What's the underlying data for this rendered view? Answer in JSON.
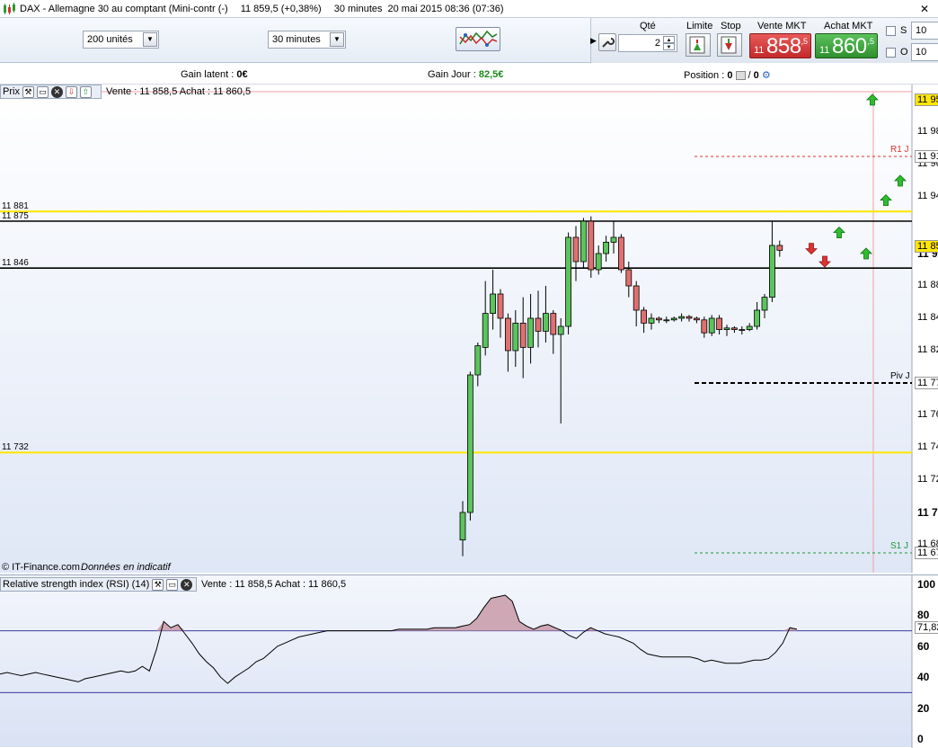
{
  "window": {
    "title": "DAX - Allemagne 30 au comptant (Mini-contr (-)",
    "price": "11 859,5 (+0,38%)",
    "interval": "30 minutes",
    "datetime": "20 mai 2015 08:36 (07:36)"
  },
  "toolbar": {
    "units_select": "200 unités",
    "interval_select": "30 minutes"
  },
  "order": {
    "qty_label": "Qté",
    "qty_value": "2",
    "limit_label": "Limite",
    "stop_label": "Stop",
    "sell_label": "Vente MKT",
    "buy_label": "Achat MKT",
    "sell_small": "11",
    "sell_big": "858",
    "sell_sup": ",5",
    "buy_small": "11",
    "buy_big": "860",
    "buy_sup": ",5",
    "s_label": "S",
    "o_label": "O",
    "s_value": "10",
    "o_value": "10"
  },
  "info": {
    "gain_latent_label": "Gain latent : ",
    "gain_latent_value": "0€",
    "gain_jour_label": "Gain Jour : ",
    "gain_jour_value": "82,5€",
    "position_label": "Position : ",
    "position_value_1": "0",
    "position_sep": " / ",
    "position_value_2": "0"
  },
  "main_panel": {
    "name": "Prix",
    "quote": "Vente : 11 858,5 Achat : 11 860,5",
    "footer_brand": "© IT-Finance.com",
    "footer_note": "Données en indicatif",
    "levels": [
      {
        "label": "11 881",
        "value": 11881,
        "color": "#ffe600"
      },
      {
        "label": "11 875",
        "value": 11875,
        "color": "#000000"
      },
      {
        "label": "11 846",
        "value": 11846,
        "color": "#000000"
      },
      {
        "label": "11 732",
        "value": 11732,
        "color": "#ffe600"
      }
    ],
    "pivots": [
      {
        "label": "R1 J",
        "value": 11915,
        "color": "#e03030"
      },
      {
        "label": "Piv J",
        "value": 11775,
        "color": "#000000"
      },
      {
        "label": "S1 J",
        "value": 11670,
        "color": "#1a9a3a"
      }
    ],
    "axis_labels": [
      {
        "text": "11 95",
        "value": 11950,
        "bold": false
      },
      {
        "text": "11 98",
        "value": 11930,
        "bold": false
      },
      {
        "text": "11 96",
        "value": 11910,
        "bold": false
      },
      {
        "text": "11 94",
        "value": 11890,
        "bold": false
      },
      {
        "text": "11 9",
        "value": 11855,
        "bold": true
      },
      {
        "text": "11 88",
        "value": 11835,
        "bold": false
      },
      {
        "text": "11 84",
        "value": 11815,
        "bold": false
      },
      {
        "text": "11 82",
        "value": 11795,
        "bold": false
      },
      {
        "text": "11 8",
        "value": 11775,
        "bold": true
      },
      {
        "text": "11 76",
        "value": 11755,
        "bold": false
      },
      {
        "text": "11 74",
        "value": 11735,
        "bold": false
      },
      {
        "text": "11 72",
        "value": 11715,
        "bold": false
      },
      {
        "text": "11 7",
        "value": 11695,
        "bold": true
      },
      {
        "text": "11 68",
        "value": 11675,
        "bold": false
      }
    ],
    "tags": [
      {
        "text": "11 95",
        "value": 11950,
        "bg": "#ffe600"
      },
      {
        "text": "11 91",
        "value": 11915,
        "bg": "#ffffff"
      },
      {
        "text": "11 85",
        "value": 11859.5,
        "bg": "#ffe600"
      },
      {
        "text": "11 77",
        "value": 11775,
        "bg": "#ffffff"
      },
      {
        "text": "11 67",
        "value": 11670,
        "bg": "#ffffff"
      }
    ]
  },
  "chart_data": {
    "type": "candlestick",
    "ylim": [
      11665,
      11955
    ],
    "candles": [
      [
        11678,
        11695,
        11668,
        11702
      ],
      [
        11695,
        11780,
        11690,
        11782
      ],
      [
        11780,
        11798,
        11773,
        11800
      ],
      [
        11797,
        11818,
        11792,
        11838
      ],
      [
        11818,
        11830,
        11808,
        11845
      ],
      [
        11830,
        11815,
        11803,
        11833
      ],
      [
        11815,
        11795,
        11782,
        11818
      ],
      [
        11795,
        11812,
        11785,
        11820
      ],
      [
        11812,
        11797,
        11778,
        11828
      ],
      [
        11797,
        11815,
        11787,
        11830
      ],
      [
        11815,
        11807,
        11797,
        11832
      ],
      [
        11807,
        11818,
        11800,
        11835
      ],
      [
        11818,
        11805,
        11793,
        11820
      ],
      [
        11805,
        11810,
        11750,
        11815
      ],
      [
        11810,
        11865,
        11805,
        11868
      ],
      [
        11865,
        11850,
        11838,
        11872
      ],
      [
        11850,
        11875,
        11846,
        11877
      ],
      [
        11875,
        11845,
        11840,
        11878
      ],
      [
        11845,
        11855,
        11842,
        11860
      ],
      [
        11855,
        11862,
        11850,
        11866
      ],
      [
        11862,
        11865,
        11855,
        11875
      ],
      [
        11865,
        11845,
        11843,
        11867
      ],
      [
        11845,
        11835,
        11828,
        11850
      ],
      [
        11835,
        11820,
        11810,
        11838
      ],
      [
        11820,
        11812,
        11806,
        11822
      ],
      [
        11812,
        11815,
        11808,
        11818
      ],
      [
        11815,
        11814,
        11812,
        11816
      ],
      [
        11814,
        11814,
        11812,
        11816
      ],
      [
        11814,
        11815,
        11813,
        11816
      ],
      [
        11815,
        11816,
        11813,
        11818
      ],
      [
        11816,
        11815,
        11813,
        11817
      ],
      [
        11815,
        11814,
        11812,
        11816
      ],
      [
        11814,
        11806,
        11803,
        11816
      ],
      [
        11806,
        11815,
        11804,
        11817
      ],
      [
        11815,
        11808,
        11805,
        11817
      ],
      [
        11808,
        11809,
        11804,
        11811
      ],
      [
        11809,
        11808,
        11806,
        11810
      ],
      [
        11808,
        11808,
        11805,
        11810
      ],
      [
        11808,
        11810,
        11807,
        11812
      ],
      [
        11810,
        11820,
        11808,
        11825
      ],
      [
        11820,
        11828,
        11815,
        11830
      ],
      [
        11828,
        11860,
        11825,
        11875
      ],
      [
        11860,
        11857,
        11853,
        11863
      ]
    ],
    "arrows_up": [
      11950,
      11855,
      11868,
      11888,
      11900
    ],
    "arrows_down": [
      11858,
      11850
    ]
  },
  "rsi_panel": {
    "name": "Relative strength index (RSI) (14)",
    "quote": "Vente : 11 858,5 Achat : 11 860,5",
    "ylim": [
      0,
      100
    ],
    "overbought": 70,
    "oversold": 30,
    "axis_labels": [
      {
        "text": "100",
        "value": 100
      },
      {
        "text": "80",
        "value": 80
      },
      {
        "text": "60",
        "value": 60
      },
      {
        "text": "40",
        "value": 40
      },
      {
        "text": "20",
        "value": 20
      },
      {
        "text": "0",
        "value": 0
      }
    ],
    "tag": {
      "text": "71,82",
      "value": 71.82
    },
    "values": [
      42,
      43,
      42,
      41,
      42,
      43,
      42,
      41,
      40,
      39,
      38,
      37,
      39,
      40,
      41,
      42,
      43,
      44,
      43,
      44,
      47,
      44,
      58,
      76,
      72,
      74,
      68,
      62,
      55,
      50,
      46,
      40,
      36,
      40,
      43,
      46,
      50,
      52,
      56,
      60,
      62,
      64,
      66,
      67,
      68,
      69,
      70,
      70,
      70,
      70,
      70,
      70,
      70,
      70,
      70,
      70,
      71,
      71,
      71,
      71,
      71,
      72,
      72,
      72,
      72,
      73,
      74,
      78,
      85,
      91,
      92,
      93,
      89,
      76,
      73,
      71,
      73,
      74,
      72,
      70,
      67,
      65,
      69,
      72,
      70,
      68,
      67,
      66,
      64,
      62,
      58,
      55,
      54,
      53,
      53,
      53,
      53,
      53,
      52,
      50,
      51,
      50,
      49,
      49,
      49,
      50,
      51,
      51,
      52,
      56,
      62,
      72,
      71
    ]
  }
}
